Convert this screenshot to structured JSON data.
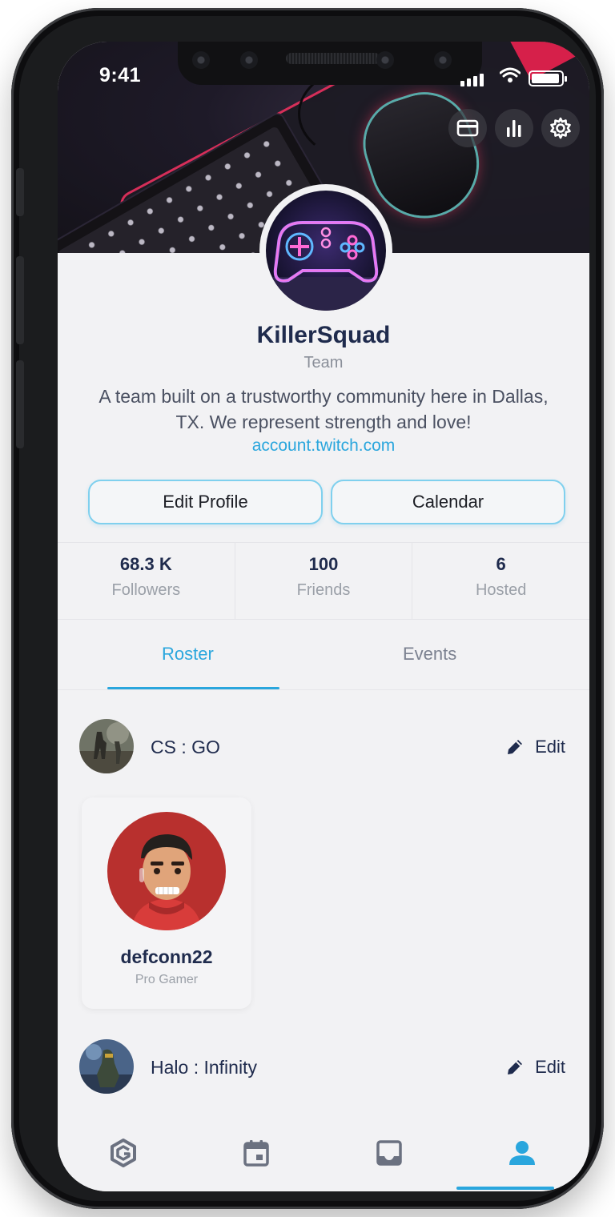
{
  "status_bar": {
    "time": "9:41"
  },
  "profile": {
    "name": "KillerSquad",
    "type": "Team",
    "bio": "A team built on a trustworthy community here in Dallas, TX. We represent strength and love!",
    "link": "account.twitch.com"
  },
  "actions": {
    "edit_profile": "Edit Profile",
    "calendar": "Calendar"
  },
  "stats": [
    {
      "value": "68.3 K",
      "label": "Followers"
    },
    {
      "value": "100",
      "label": "Friends"
    },
    {
      "value": "6",
      "label": "Hosted"
    }
  ],
  "tabs": {
    "active": "Roster",
    "other": "Events"
  },
  "roster": [
    {
      "game": "CS : GO",
      "edit_label": "Edit",
      "members": [
        {
          "name": "defconn22",
          "role": "Pro Gamer"
        }
      ]
    },
    {
      "game": "Halo : Infinity",
      "edit_label": "Edit"
    }
  ],
  "banner_icons": [
    "card-icon",
    "stats-icon",
    "gear-icon"
  ],
  "nav": {
    "items": [
      "logo-icon",
      "calendar-icon",
      "inbox-icon",
      "profile-icon"
    ],
    "active": "profile-icon"
  },
  "colors": {
    "accent": "#2aa6dd",
    "text_dark": "#1f2b4d",
    "muted": "#9ba0a8"
  }
}
